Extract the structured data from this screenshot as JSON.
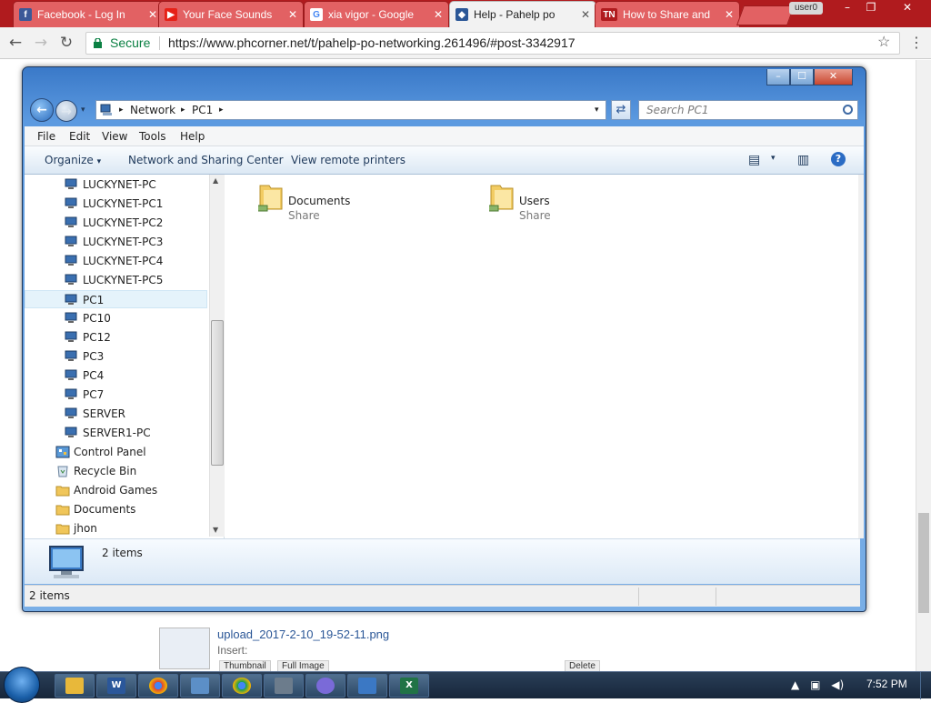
{
  "browser": {
    "tabs": [
      {
        "title": "Facebook - Log In",
        "icon": "facebook-icon",
        "color": "#3b5998"
      },
      {
        "title": "Your Face Sounds",
        "icon": "youtube-icon",
        "color": "#e62117"
      },
      {
        "title": "xia vigor - Google",
        "icon": "google-icon",
        "color": "#4285f4"
      },
      {
        "title": "Help - Pahelp po",
        "icon": "phcorner-icon",
        "color": "#2b5797"
      },
      {
        "title": "How to Share and",
        "icon": "tn-icon",
        "color": "#cc2222"
      }
    ],
    "user_badge": "user0",
    "secure_label": "Secure",
    "url": "https://www.phcorner.net/t/pahelp-po-networking.261496/#post-3342917"
  },
  "attachment": {
    "filename": "upload_2017-2-10_19-52-11.png",
    "insert_label": "Insert:",
    "thumbnail_label": "Thumbnail",
    "full_image_label": "Full Image",
    "delete_label": "Delete"
  },
  "explorer": {
    "breadcrumb": [
      "Network",
      "PC1"
    ],
    "search_placeholder": "Search PC1",
    "menu": [
      "File",
      "Edit",
      "View",
      "Tools",
      "Help"
    ],
    "toolbar": {
      "organize": "Organize",
      "network_center": "Network and Sharing Center",
      "remote_printers": "View remote printers"
    },
    "nav_items": [
      {
        "label": "LUCKYNET-PC",
        "icon": "computer-icon"
      },
      {
        "label": "LUCKYNET-PC1",
        "icon": "computer-icon"
      },
      {
        "label": "LUCKYNET-PC2",
        "icon": "computer-icon"
      },
      {
        "label": "LUCKYNET-PC3",
        "icon": "computer-icon"
      },
      {
        "label": "LUCKYNET-PC4",
        "icon": "computer-icon"
      },
      {
        "label": "LUCKYNET-PC5",
        "icon": "computer-icon"
      },
      {
        "label": "PC1",
        "icon": "computer-icon",
        "selected": true
      },
      {
        "label": "PC10",
        "icon": "computer-icon"
      },
      {
        "label": "PC12",
        "icon": "computer-icon"
      },
      {
        "label": "PC3",
        "icon": "computer-icon"
      },
      {
        "label": "PC4",
        "icon": "computer-icon"
      },
      {
        "label": "PC7",
        "icon": "computer-icon"
      },
      {
        "label": "SERVER",
        "icon": "computer-icon"
      },
      {
        "label": "SERVER1-PC",
        "icon": "computer-icon"
      },
      {
        "label": "Control Panel",
        "icon": "control-panel-icon"
      },
      {
        "label": "Recycle Bin",
        "icon": "recycle-bin-icon"
      },
      {
        "label": "Android Games",
        "icon": "folder-icon"
      },
      {
        "label": "Documents",
        "icon": "folder-icon"
      },
      {
        "label": "jhon",
        "icon": "folder-icon"
      }
    ],
    "shares": [
      {
        "name": "Documents",
        "type": "Share"
      },
      {
        "name": "Users",
        "type": "Share"
      }
    ],
    "details_count": "2 items",
    "status_count": "2 items"
  },
  "taskbar": {
    "apps": [
      {
        "name": "explorer-taskbar-icon",
        "color": "#e8b83a",
        "glyph": ""
      },
      {
        "name": "word-taskbar-icon",
        "color": "#2b579a",
        "glyph": "W"
      },
      {
        "name": "chrome-taskbar-icon",
        "color": "#db4437",
        "glyph": ""
      },
      {
        "name": "network-taskbar-icon",
        "color": "#5c8fc7",
        "glyph": ""
      },
      {
        "name": "chrome-2-taskbar-icon",
        "color": "#0f9d58",
        "glyph": ""
      },
      {
        "name": "mail-taskbar-icon",
        "color": "#6c7c8c",
        "glyph": ""
      },
      {
        "name": "games-taskbar-icon",
        "color": "#7a6ad8",
        "glyph": ""
      },
      {
        "name": "remote-desktop-taskbar-icon",
        "color": "#3b78c4",
        "glyph": ""
      },
      {
        "name": "excel-taskbar-icon",
        "color": "#217346",
        "glyph": "X"
      }
    ],
    "clock": "7:52 PM"
  }
}
